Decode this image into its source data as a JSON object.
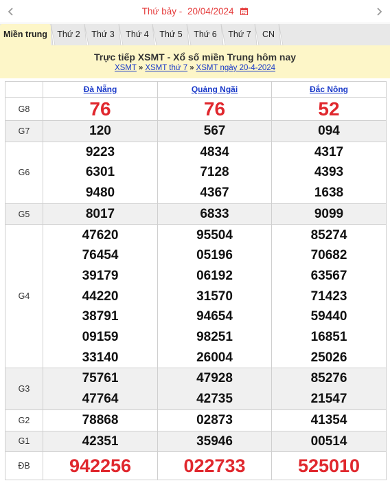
{
  "header": {
    "prev_icon": "chevron-left",
    "next_icon": "chevron-right",
    "day_label": "Thứ bảy -",
    "date": "20/04/2024",
    "calendar_icon": "calendar-icon",
    "accent_color": "#e53b3b"
  },
  "tabs": [
    {
      "label": "Miền trung",
      "active": true
    },
    {
      "label": "Thứ 2"
    },
    {
      "label": "Thứ 3"
    },
    {
      "label": "Thứ 4"
    },
    {
      "label": "Thứ 5"
    },
    {
      "label": "Thứ 6"
    },
    {
      "label": "Thứ 7"
    },
    {
      "label": "CN"
    }
  ],
  "banner": {
    "title": "Trực tiếp XSMT - Xổ số miền Trung hôm nay",
    "crumbs": [
      "XSMT",
      "XSMT thứ 7",
      "XSMT ngày 20-4-2024"
    ],
    "crumb_sep": "»"
  },
  "provinces": [
    "Đà Nẵng",
    "Quảng Ngãi",
    "Đắc Nông"
  ],
  "prizes": {
    "g8": {
      "label": "G8",
      "values": [
        [
          "76"
        ],
        [
          "76"
        ],
        [
          "52"
        ]
      ]
    },
    "g7": {
      "label": "G7",
      "values": [
        [
          "120"
        ],
        [
          "567"
        ],
        [
          "094"
        ]
      ]
    },
    "g6": {
      "label": "G6",
      "values": [
        [
          "9223",
          "6301",
          "9480"
        ],
        [
          "4834",
          "7128",
          "4367"
        ],
        [
          "4317",
          "4393",
          "1638"
        ]
      ]
    },
    "g5": {
      "label": "G5",
      "values": [
        [
          "8017"
        ],
        [
          "6833"
        ],
        [
          "9099"
        ]
      ]
    },
    "g4": {
      "label": "G4",
      "values": [
        [
          "47620",
          "76454",
          "39179",
          "44220",
          "38791",
          "09159",
          "33140"
        ],
        [
          "95504",
          "05196",
          "06192",
          "31570",
          "94654",
          "98251",
          "26004"
        ],
        [
          "85274",
          "70682",
          "63567",
          "71423",
          "59440",
          "16851",
          "25026"
        ]
      ]
    },
    "g3": {
      "label": "G3",
      "values": [
        [
          "75761",
          "47764"
        ],
        [
          "47928",
          "42735"
        ],
        [
          "85276",
          "21547"
        ]
      ]
    },
    "g2": {
      "label": "G2",
      "values": [
        [
          "78868"
        ],
        [
          "02873"
        ],
        [
          "41354"
        ]
      ]
    },
    "g1": {
      "label": "G1",
      "values": [
        [
          "42351"
        ],
        [
          "35946"
        ],
        [
          "00514"
        ]
      ]
    },
    "db": {
      "label": "ĐB",
      "values": [
        [
          "942256"
        ],
        [
          "022733"
        ],
        [
          "525010"
        ]
      ]
    }
  },
  "colors": {
    "prize_red": "#e0282e",
    "link_blue": "#1a3ac9",
    "banner_bg": "#fdf6c8",
    "row_shade": "#f0f0f0"
  }
}
